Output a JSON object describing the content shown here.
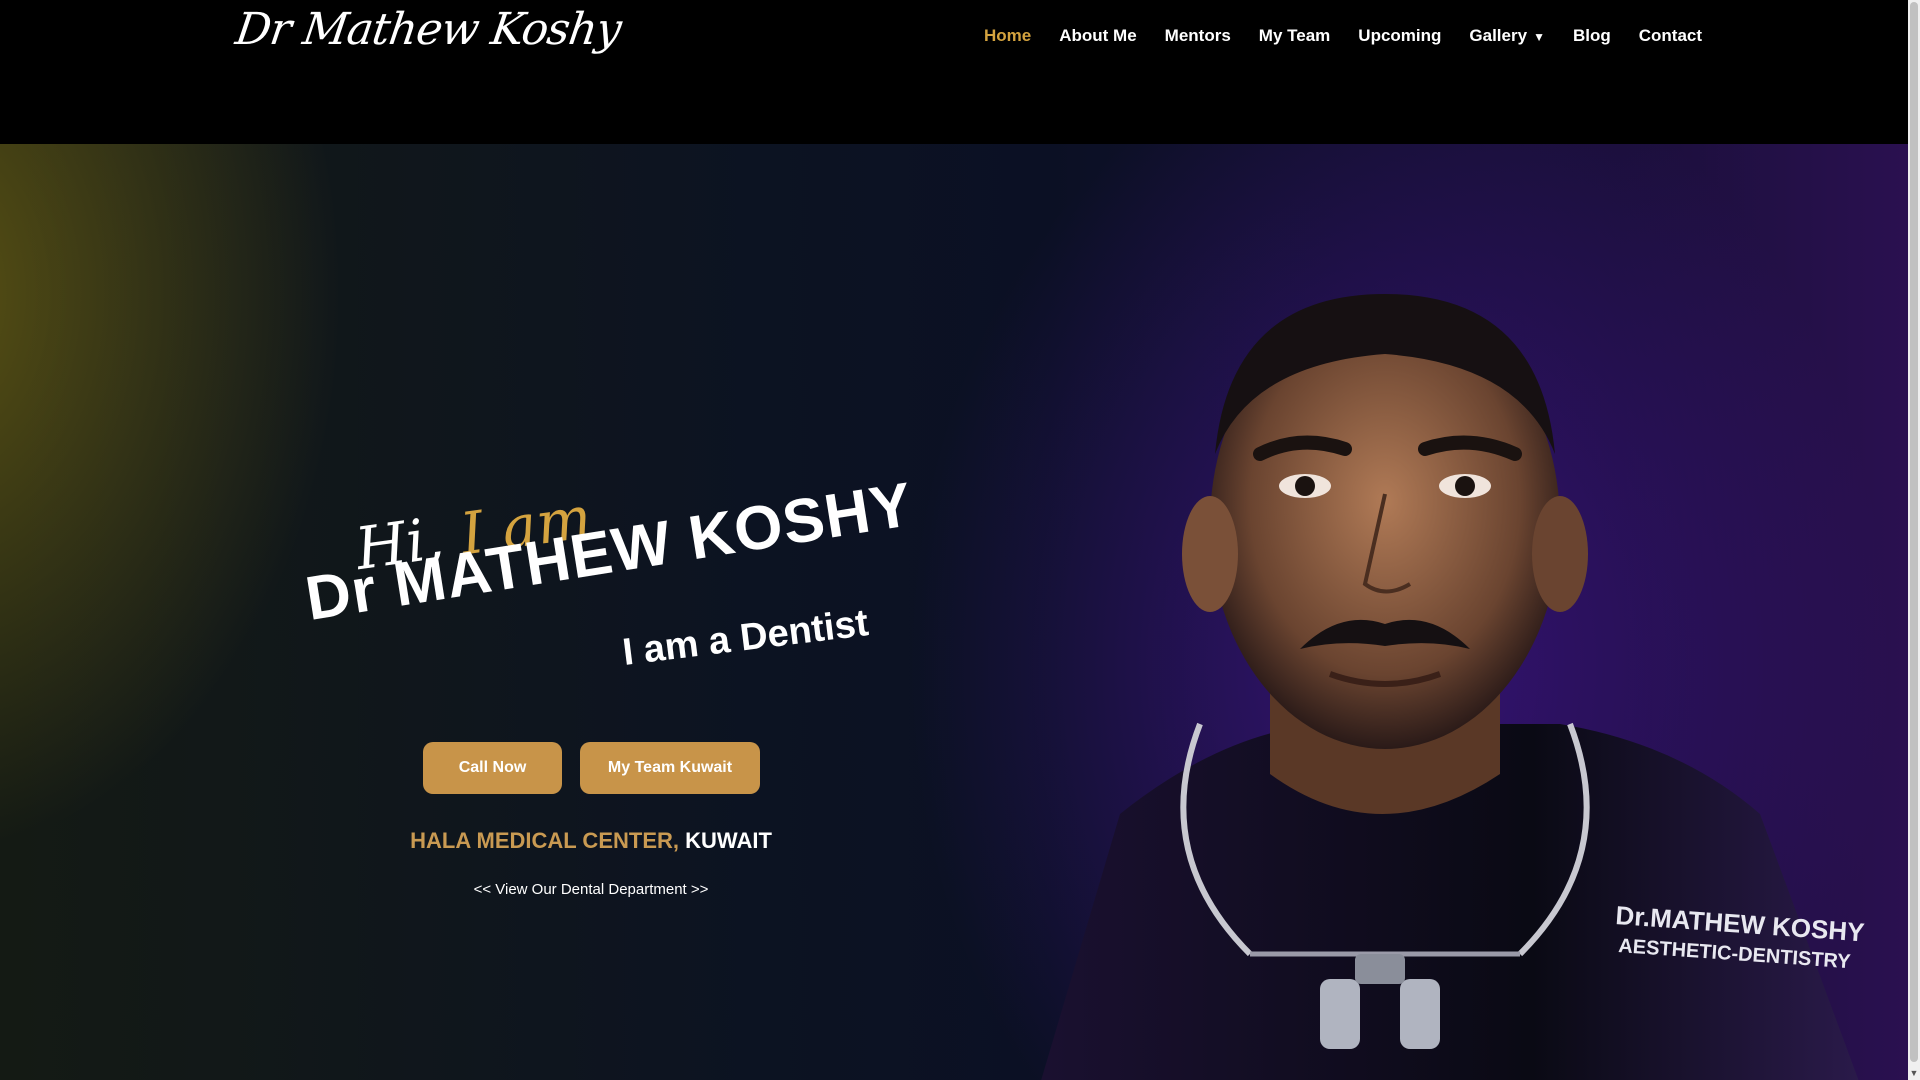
{
  "logo": {
    "text": "Dr Mathew Koshy"
  },
  "nav": [
    {
      "label": "Home"
    },
    {
      "label": "About Me"
    },
    {
      "label": "Mentors"
    },
    {
      "label": "My Team"
    },
    {
      "label": "Upcoming"
    },
    {
      "label": "Gallery"
    },
    {
      "label": "Blog"
    },
    {
      "label": "Contact"
    }
  ],
  "hero": {
    "greeting_hi": "Hi,",
    "greeting_iam": "I am",
    "name": "Dr MATHEW KOSHY",
    "tagline": "I am a Dentist",
    "call_button": "Call Now",
    "team_button": "My Team Kuwait",
    "center_gold": "HALA MEDICAL CENTER,",
    "center_white": "KUWAIT",
    "dept_link": "<< View Our Dental Department >>",
    "shirt_line1": "Dr.MATHEW KOSHY",
    "shirt_line2": "AESTHETIC-DENTISTRY"
  },
  "colors": {
    "accent_gold": "#d4a33f",
    "button_gold": "#c89449",
    "background": "#000000"
  }
}
